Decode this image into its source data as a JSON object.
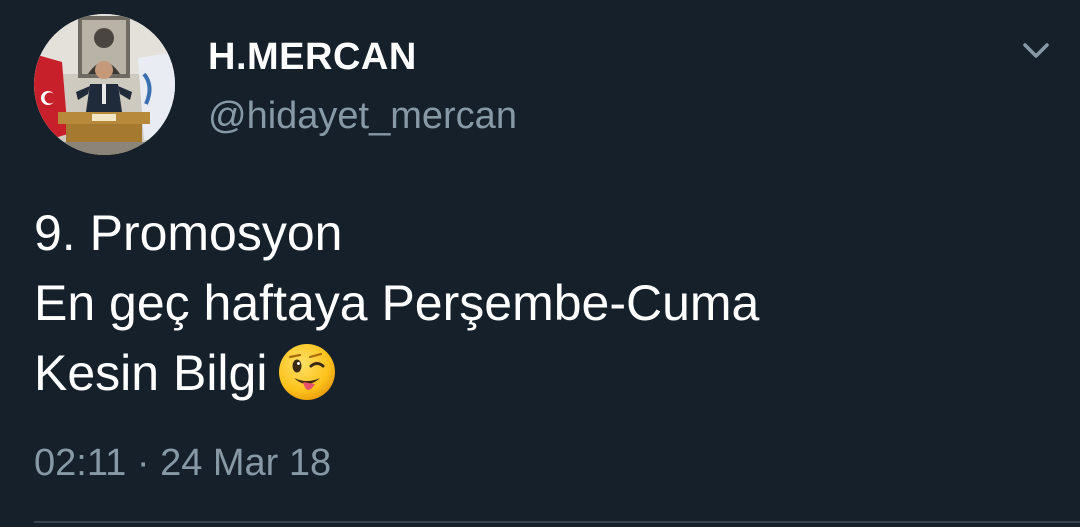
{
  "tweet": {
    "author": {
      "display_name": "H.MERCAN",
      "handle": "@hidayet_mercan",
      "avatar_icon": "profile-photo"
    },
    "menu_icon": "chevron-down-icon",
    "body_lines": [
      "9. Promosyon",
      "En geç haftaya Perşembe-Cuma",
      "Kesin Bilgi"
    ],
    "emoji": "winking-face-with-tongue",
    "time": "02:11",
    "separator": "·",
    "date": "24 Mar 18",
    "colors": {
      "background": "#15202b",
      "primary_text": "#ffffff",
      "secondary_text": "#8899a6",
      "divider": "#38444d"
    }
  }
}
